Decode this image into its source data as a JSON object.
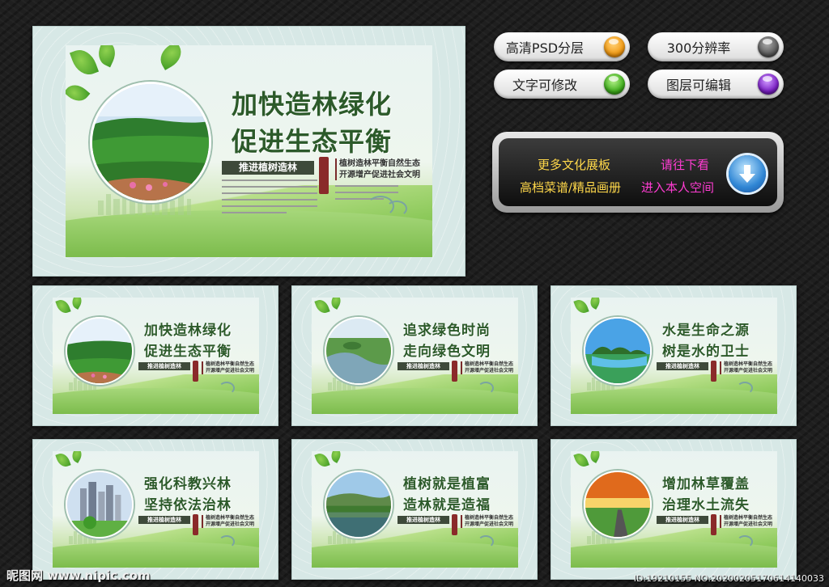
{
  "features": [
    {
      "label": "高清PSD分层",
      "color": "#f29a12"
    },
    {
      "label": "300分辨率",
      "color": "#5a5a5a"
    },
    {
      "label": "文字可修改",
      "color": "#3fae1c"
    },
    {
      "label": "图层可编辑",
      "color": "#7a1fc4"
    }
  ],
  "banner": {
    "line1": "更多文化展板",
    "line2": "高档菜谱/精品画册",
    "line3": "请往下看",
    "line4": "进入本人空间"
  },
  "main_board": {
    "title1": "加快造林绿化",
    "title2": "促进生态平衡",
    "tag": "推进植树造林",
    "slogan1": "植树造林平衡自然生态",
    "slogan2": "开源增产促进社会文明"
  },
  "thumbs": [
    {
      "title1": "加快造林绿化",
      "title2": "促进生态平衡",
      "scene": "forest"
    },
    {
      "title1": "追求绿色时尚",
      "title2": "走向绿色文明",
      "scene": "river"
    },
    {
      "title1": "水是生命之源",
      "title2": "树是水的卫士",
      "scene": "lake"
    },
    {
      "title1": "强化科教兴林",
      "title2": "坚持依法治林",
      "scene": "city"
    },
    {
      "title1": "植树就是植富",
      "title2": "造林就是造福",
      "scene": "pond"
    },
    {
      "title1": "增加林草覆盖",
      "title2": "治理水土流失",
      "scene": "sunset"
    }
  ],
  "thumb_tag": "推进植树造林",
  "thumb_slogan1": "植树造林平衡自然生态",
  "thumb_slogan2": "开源增产促进社会文明",
  "watermark": {
    "left": "昵图网 www.nipic.com",
    "right": "ID:19210155 NO:20200205170614140033"
  }
}
